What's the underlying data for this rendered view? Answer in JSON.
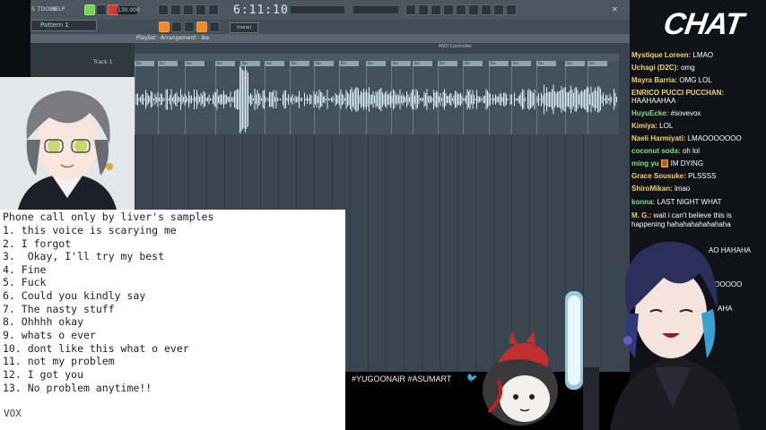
{
  "fl": {
    "menu": [
      "S",
      "TOOLS",
      "HELP"
    ],
    "bpm": "130.000",
    "time": "6:11:10",
    "pattern": "Pattern 1",
    "studio_line1": "FL STUDIO GRAVIT",
    "studio_line2": "MIDI Controller",
    "playlist_title": "Playlist · Arrangement · Ike",
    "track_name": "Track 1",
    "clip_label": "Ike"
  },
  "notes": {
    "title": "Phone call only by liver's samples",
    "items": [
      "1. this voice is scarying me",
      "2. I forgot",
      "3.  Okay, I'll try my best",
      "4. Fine",
      "5. Fuck",
      "6. Could you kindly say",
      "7. The nasty stuff",
      "8. Ohhhh okay",
      "9. whats o ever",
      "10. dont like this what o ever",
      "11. not my problem",
      "12. I got you",
      "13. No problem anytime!!"
    ],
    "footer": "VOX"
  },
  "hashtags": "#YUGOONAIR #ASUMART",
  "chat": {
    "title": "CHAT",
    "messages": [
      {
        "user": "Mystique Loreen:",
        "text": "LMAO",
        "color": "#f1d36b"
      },
      {
        "user": "Uchagi (D2C):",
        "text": "omg",
        "color": "#f1d36b"
      },
      {
        "user": "Mayra Barria:",
        "text": "OMG LOL",
        "color": "#f1d36b"
      },
      {
        "user": "ENRICO PUCCI PUCCHAN:",
        "text": "HAAHAAHAA",
        "color": "#f1d36b"
      },
      {
        "user": "HuyuEcke:",
        "text": "#sovevox",
        "color": "#7fe07f"
      },
      {
        "user": "Kimiya:",
        "text": "LOL",
        "color": "#f1d36b"
      },
      {
        "user": "Naeli Harmiyati:",
        "text": "LMAOOOOOOO",
        "color": "#f1d36b"
      },
      {
        "user": "coconut soda:",
        "text": "oh lol",
        "color": "#7fe07f"
      },
      {
        "user": "ming yu",
        "text": "IM DYING",
        "color": "#7fe07f"
      },
      {
        "user": "Grace Sousuke:",
        "text": "PLSSSS",
        "color": "#f1d36b"
      },
      {
        "user": "ShiroMikan:",
        "text": "lmao",
        "color": "#f1d36b"
      },
      {
        "user": "konna:",
        "text": "LAST NIGHT WHAT",
        "color": "#7fe07f"
      },
      {
        "user": "M. G.:",
        "text": "wait i can't believe this is",
        "color": "#f1d36b"
      },
      {
        "user": "",
        "text": "happening hahahahahahahaha",
        "color": "#f1d36b"
      },
      {
        "user": "",
        "text": "AO HAHAHA",
        "color": "#f1d36b"
      },
      {
        "user": "",
        "text": "OOOOOO",
        "color": "#f1d36b"
      },
      {
        "user": "",
        "text": "AHA",
        "color": "#f1d36b"
      }
    ]
  }
}
